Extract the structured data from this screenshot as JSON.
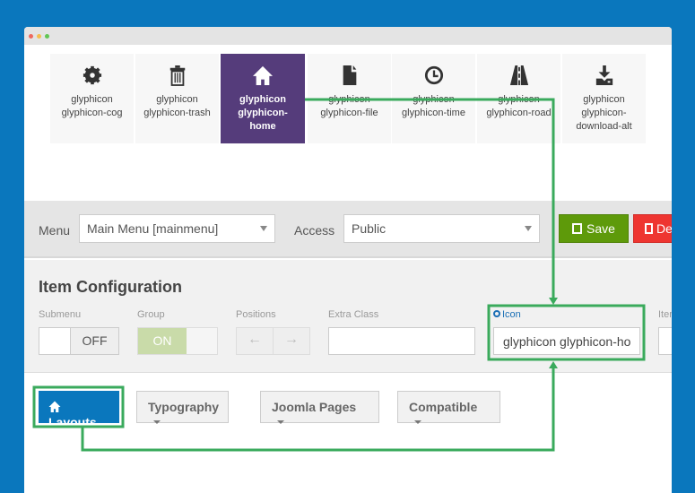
{
  "icons": [
    {
      "name": "cog",
      "l1": "glyphicon",
      "l2": "glyphicon-cog",
      "l3": ""
    },
    {
      "name": "trash",
      "l1": "glyphicon",
      "l2": "glyphicon-trash",
      "l3": ""
    },
    {
      "name": "home",
      "l1": "glyphicon",
      "l2": "glyphicon-",
      "l3": "home",
      "active": true
    },
    {
      "name": "file",
      "l1": "glyphicon",
      "l2": "glyphicon-file",
      "l3": ""
    },
    {
      "name": "time",
      "l1": "glyphicon",
      "l2": "glyphicon-time",
      "l3": ""
    },
    {
      "name": "road",
      "l1": "glyphicon",
      "l2": "glyphicon-road",
      "l3": ""
    },
    {
      "name": "download-alt",
      "l1": "glyphicon",
      "l2": "glyphicon-",
      "l3": "download-alt"
    }
  ],
  "toolbar": {
    "menu_label": "Menu",
    "menu_value": "Main Menu [mainmenu]",
    "access_label": "Access",
    "access_value": "Public",
    "save": "Save",
    "delete": "De"
  },
  "config": {
    "title": "Item Configuration",
    "submenu": "Submenu",
    "submenu_value": "OFF",
    "group": "Group",
    "group_value": "ON",
    "positions": "Positions",
    "extra_class": "Extra Class",
    "icon": "Icon",
    "icon_value": "glyphicon glyphicon-ho",
    "item": "Item"
  },
  "tabs": {
    "layouts": "Layouts",
    "typography": "Typography",
    "joomla": "Joomla Pages",
    "compatible": "Compatible"
  },
  "colors": {
    "accent": "#0a77bd",
    "active_tile": "#553c7b",
    "save": "#5e9a0a",
    "delete": "#ee3530",
    "annotation": "#3aaa5c"
  }
}
